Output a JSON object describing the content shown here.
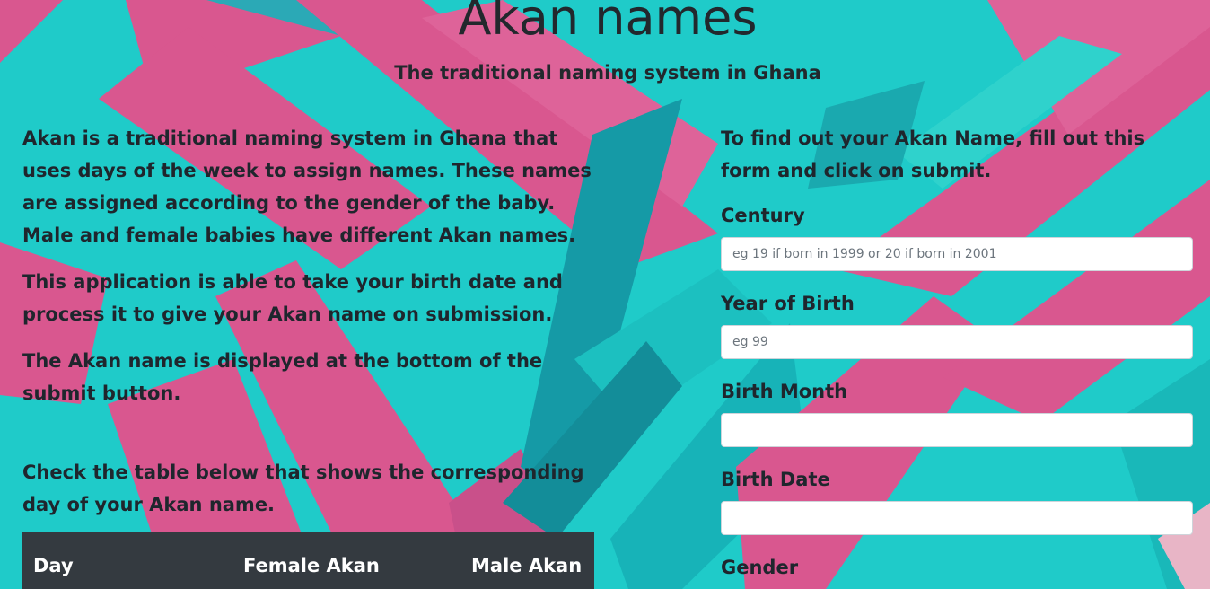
{
  "header": {
    "title": "Akan names",
    "subtitle": "The traditional naming system in Ghana"
  },
  "about": {
    "paragraphs": [
      "Akan is a traditional naming system in Ghana that uses days of the week to assign names. These names are assigned according to the gender of the baby. Male and female babies have different Akan names.",
      "This application is able to take your birth date and process it to give your Akan name on submission.",
      "The Akan name is displayed at the bottom of the submit button."
    ],
    "table_intro": "Check the table below that shows the corresponding day of your Akan name."
  },
  "table": {
    "columns": [
      "Day",
      "Female Akan",
      "Male Akan"
    ]
  },
  "form": {
    "intro": "To find out your Akan Name, fill out this form and click on submit.",
    "fields": [
      {
        "label": "Century",
        "placeholder": "eg 19 if born in 1999 or 20 if born in 2001",
        "value": ""
      },
      {
        "label": "Year of Birth",
        "placeholder": "eg 99",
        "value": ""
      },
      {
        "label": "Birth Month",
        "placeholder": "",
        "value": ""
      },
      {
        "label": "Birth Date",
        "placeholder": "",
        "value": ""
      },
      {
        "label": "Gender"
      }
    ]
  },
  "theme": {
    "background": "#1fcbc9",
    "accent_pink": "#d9578f",
    "table_header_bg": "#343a40"
  }
}
